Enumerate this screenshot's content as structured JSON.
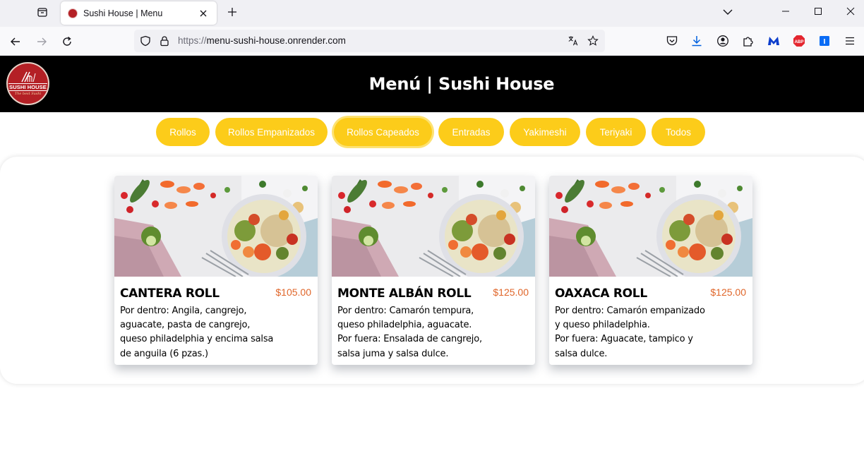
{
  "browser": {
    "tab_title": "Sushi House | Menu",
    "url_protocol": "https://",
    "url_host": "menu-sushi-house.onrender.com",
    "extension_i_label": "I",
    "extension_abp_label": "ABP"
  },
  "header": {
    "title": "Menú | Sushi House",
    "logo_brand": "SUSHI HOUSE",
    "logo_tagline": "The best Sushi"
  },
  "categories": [
    {
      "label": "Rollos",
      "active": false
    },
    {
      "label": "Rollos Empanizados",
      "active": false
    },
    {
      "label": "Rollos Capeados",
      "active": true
    },
    {
      "label": "Entradas",
      "active": false
    },
    {
      "label": "Yakimeshi",
      "active": false
    },
    {
      "label": "Teriyaki",
      "active": false
    },
    {
      "label": "Todos",
      "active": false
    }
  ],
  "colors": {
    "accent": "#fccc1a",
    "header_bg": "#000000",
    "price": "#e0662a",
    "logo_red": "#b42025"
  },
  "menu_items": [
    {
      "name": "CANTERA ROLL",
      "price": "$105.00",
      "description": "Por dentro: Angila, cangrejo,\naguacate, pasta de cangrejo,\nqueso philadelphia y encima salsa\nde anguila (6 pzas.)"
    },
    {
      "name": "MONTE ALBÁN ROLL",
      "price": "$125.00",
      "description": "Por dentro: Camarón tempura,\nqueso philadelphia, aguacate.\nPor fuera: Ensalada de cangrejo,\nsalsa juma y salsa dulce."
    },
    {
      "name": "OAXACA ROLL",
      "price": "$125.00",
      "description": "Por dentro: Camarón empanizado\ny queso philadelphia.\nPor fuera: Aguacate, tampico y\nsalsa dulce."
    }
  ]
}
